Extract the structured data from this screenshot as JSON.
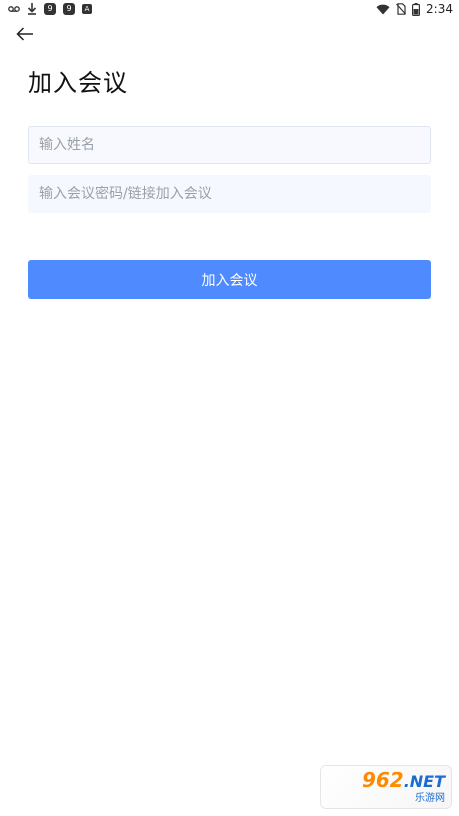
{
  "status_bar": {
    "left_icons": [
      "voicemail-icon",
      "download-icon",
      "app-badge-icon",
      "app-badge-icon",
      "app-badge-icon"
    ],
    "badge_letters": [
      "9",
      "9",
      "A"
    ],
    "time": "2:34",
    "right_icons": [
      "wifi-icon",
      "no-sim-icon",
      "battery-icon"
    ]
  },
  "header": {
    "back_icon": "arrow-left-icon",
    "title": "加入会议"
  },
  "form": {
    "name_placeholder": "输入姓名",
    "password_placeholder": "输入会议密码/链接加入会议",
    "join_label": "加入会议"
  },
  "watermark": {
    "number": "962",
    "domain": ".NET",
    "subtitle": "乐游网"
  },
  "colors": {
    "primary": "#4f8bff",
    "input_bg": "#f5f8ff",
    "title": "#111111",
    "placeholder": "#9aa0aa"
  }
}
